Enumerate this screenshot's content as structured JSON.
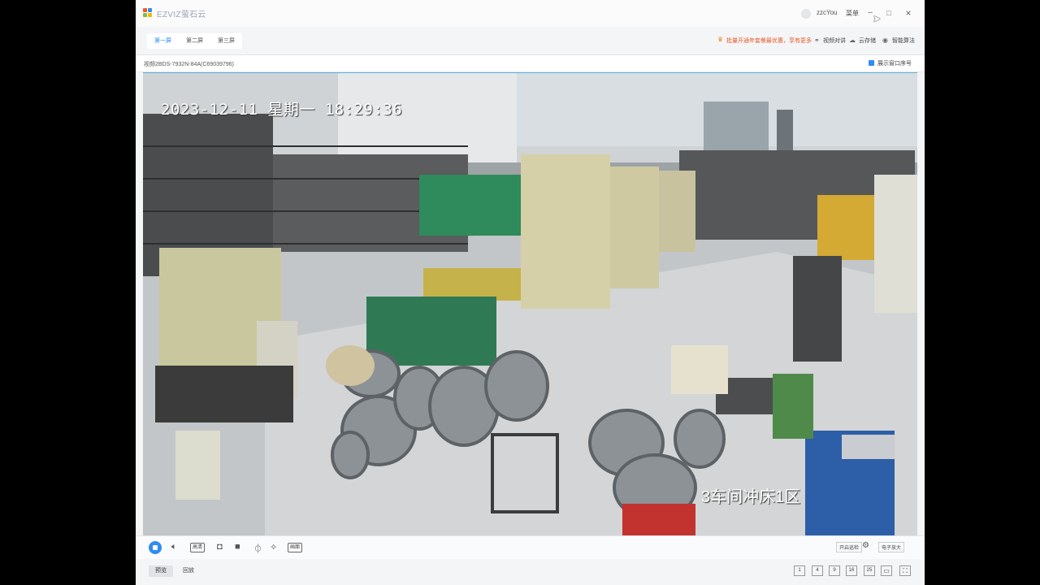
{
  "app": {
    "brand": "EZVIZ萤石云",
    "user": "zzcYou",
    "menu_label": "菜单",
    "minimize": "–",
    "maximize": "□",
    "close": "×"
  },
  "tabs": [
    "第一屏",
    "第二屏",
    "第三屏"
  ],
  "toolbar": {
    "promo": "批量开通年套餐最优惠，享有更多",
    "tools": [
      {
        "icon": "link-icon",
        "label": "视频对讲"
      },
      {
        "icon": "cloud-icon",
        "label": "云存储"
      },
      {
        "icon": "ai-icon",
        "label": "智能算法"
      }
    ]
  },
  "device": {
    "name": "视频2BDS-7932N-84A(C69039796)",
    "show_window_number": "展示窗口序号"
  },
  "video": {
    "osd_time": "2023-12-11 星期一 18:29:36",
    "osd_zone": "3车间冲床1区"
  },
  "controls": {
    "quality": "高清",
    "other": "画面",
    "realtime": "开启巡检",
    "zoom": "电子放大"
  },
  "footer": {
    "preview": "预览",
    "playback": "回放",
    "layouts": [
      "1",
      "4",
      "9",
      "16",
      "25"
    ]
  },
  "colors": {
    "accent": "#2f8cf0",
    "promo": "#e85a2a"
  }
}
